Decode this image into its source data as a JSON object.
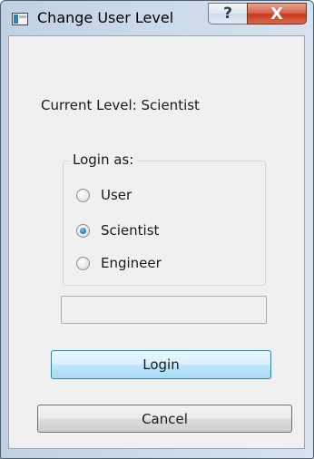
{
  "window": {
    "title": "Change User Level",
    "help_label": "?",
    "close_label": "X"
  },
  "current_level_text": "Current Level: Scientist",
  "login_group": {
    "label": "Login as:",
    "options": [
      {
        "label": "User",
        "selected": false
      },
      {
        "label": "Scientist",
        "selected": true
      },
      {
        "label": "Engineer",
        "selected": false
      }
    ]
  },
  "password_field": {
    "value": "",
    "placeholder": ""
  },
  "buttons": {
    "login_label": "Login",
    "cancel_label": "Cancel"
  }
}
